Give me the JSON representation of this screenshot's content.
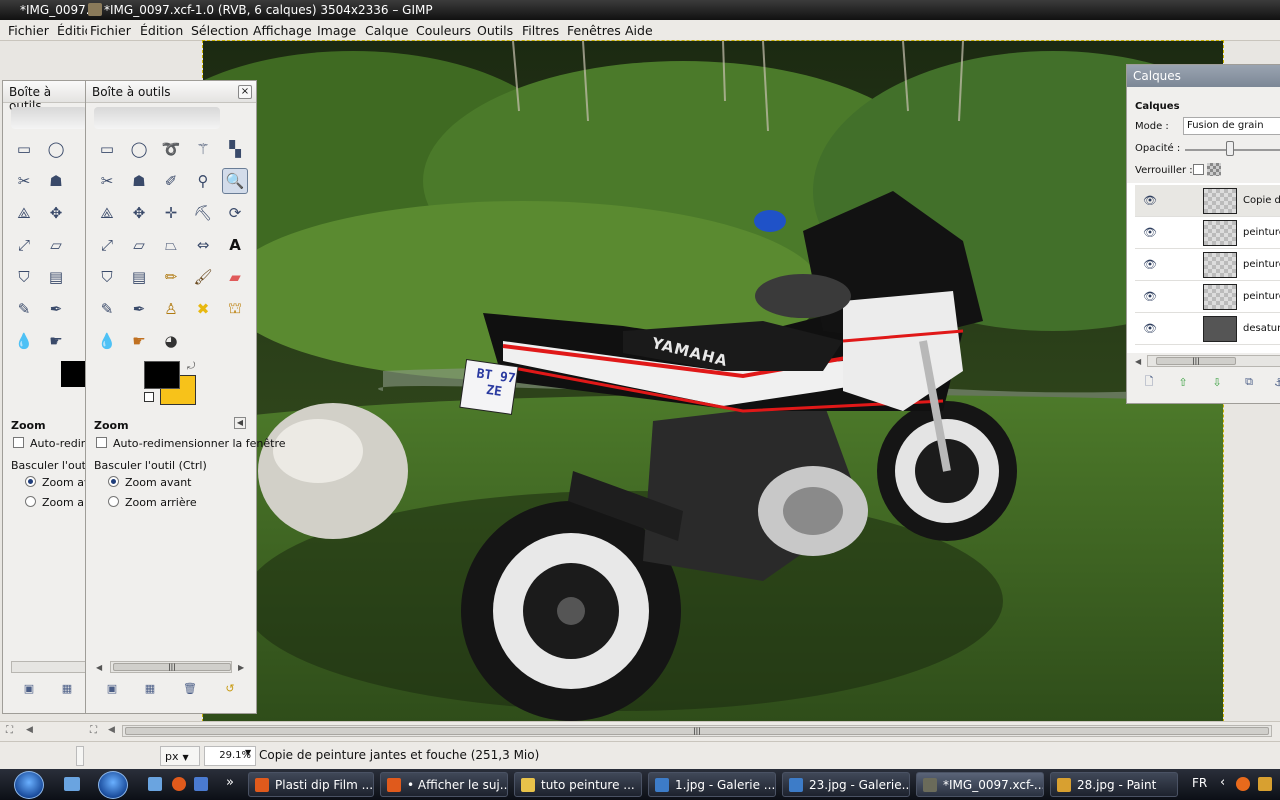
{
  "window": {
    "title_left": "*IMG_0097.",
    "title": "*IMG_0097.xcf-1.0 (RVB, 6 calques) 3504x2336 – GIMP"
  },
  "menubar": {
    "ghost_items": [
      "Fichier",
      "Éditio"
    ],
    "items": [
      "Fichier",
      "Édition",
      "Sélection",
      "Affichage",
      "Image",
      "Calque",
      "Couleurs",
      "Outils",
      "Filtres",
      "Fenêtres",
      "Aide"
    ]
  },
  "toolbox_back": {
    "title": "Boîte à outils",
    "options_title": "Zoom",
    "auto_resize": "Auto-redime",
    "switch_tool": "Basculer l'outil  (C",
    "zoom_in": "Zoom av",
    "zoom_out": "Zoom arr"
  },
  "toolbox_front": {
    "title": "Boîte à outils",
    "close": "×",
    "options_title": "Zoom",
    "auto_resize": "Auto-redimensionner la fenêtre",
    "switch_tool": "Basculer l'outil  (Ctrl)",
    "zoom_in": "Zoom avant",
    "zoom_out": "Zoom arrière",
    "fg_color": "#000000",
    "bg_color": "#f7c21a",
    "active_tool": "zoom-tool"
  },
  "layers_panel": {
    "window_title": "Calques",
    "section_title": "Calques",
    "mode_label": "Mode :",
    "mode_value": "Fusion de grain",
    "opacity_label": "Opacité :",
    "opacity_value": 0.45,
    "lock_label": "Verrouiller :",
    "layers": [
      {
        "name": "Copie de",
        "selected": true
      },
      {
        "name": "peinture",
        "selected": false
      },
      {
        "name": "peinture",
        "selected": false
      },
      {
        "name": "peinture",
        "selected": false
      },
      {
        "name": "desatura",
        "selected": false
      }
    ]
  },
  "statusbar": {
    "unit": "px",
    "zoom": "29.1%",
    "message": "Copie de peinture jantes et fouche (251,3 Mio)"
  },
  "photo": {
    "plate": "BT 97 ZE",
    "brand": "YAMAHA"
  },
  "taskbar": {
    "tasks": [
      {
        "label": "Plasti dip Film ...",
        "color": "#e05a1c"
      },
      {
        "label": "• Afficher le suj...",
        "color": "#e05a1c"
      },
      {
        "label": "tuto peinture ...",
        "color": "#e8c24a"
      },
      {
        "label": "1.jpg - Galerie ...",
        "color": "#3d7cc8"
      },
      {
        "label": "23.jpg - Galerie...",
        "color": "#3d7cc8"
      },
      {
        "label": "*IMG_0097.xcf-...",
        "color": "#6b6b5a"
      },
      {
        "label": "28.jpg - Paint",
        "color": "#d8a030"
      }
    ],
    "lang": "FR",
    "overflow": "»"
  }
}
